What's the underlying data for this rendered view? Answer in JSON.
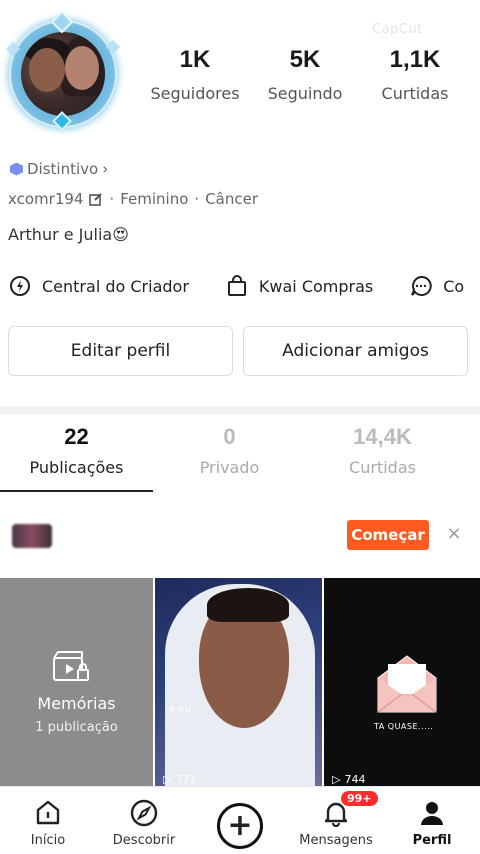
{
  "watermark": "CapCut",
  "profile": {
    "stats": [
      {
        "value": "1K",
        "label": "Seguidores"
      },
      {
        "value": "5K",
        "label": "Seguindo"
      },
      {
        "value": "1,1K",
        "label": "Curtidas"
      }
    ],
    "badge_label": "Distintivo",
    "username": "xcomr194",
    "gender": "Feminino",
    "sign": "Câncer",
    "bio": "Arthur e Julia😍"
  },
  "shortcuts": [
    {
      "icon": "lightning-icon",
      "label": "Central do Criador"
    },
    {
      "icon": "bag-icon",
      "label": "Kwai Compras"
    },
    {
      "icon": "chat-icon",
      "label": "Co"
    }
  ],
  "buttons": {
    "edit_profile": "Editar perfil",
    "add_friends": "Adicionar amigos"
  },
  "tabs": [
    {
      "count": "22",
      "label": "Publicações",
      "active": true
    },
    {
      "count": "0",
      "label": "Privado",
      "active": false
    },
    {
      "count": "14,4K",
      "label": "Curtidas",
      "active": false
    }
  ],
  "banner": {
    "start_label": "Começar",
    "close_label": "×"
  },
  "grid": {
    "memories_title": "Memórias",
    "memories_sub": "1 publicação",
    "photo_caption": "e eu..",
    "photo_views": "771",
    "dark_caption": "TA QUASE.....",
    "dark_views": "744"
  },
  "nav": [
    {
      "icon": "home-icon",
      "label": "Início"
    },
    {
      "icon": "compass-icon",
      "label": "Descobrir"
    },
    {
      "icon": "plus-icon",
      "label": ""
    },
    {
      "icon": "bell-icon",
      "label": "Mensagens",
      "badge": "99+"
    },
    {
      "icon": "person-icon",
      "label": "Perfil"
    }
  ],
  "colors": {
    "accent": "#ff5a1f",
    "badge_red": "#ff2c2c",
    "memories_bg": "#8c8c8c"
  }
}
